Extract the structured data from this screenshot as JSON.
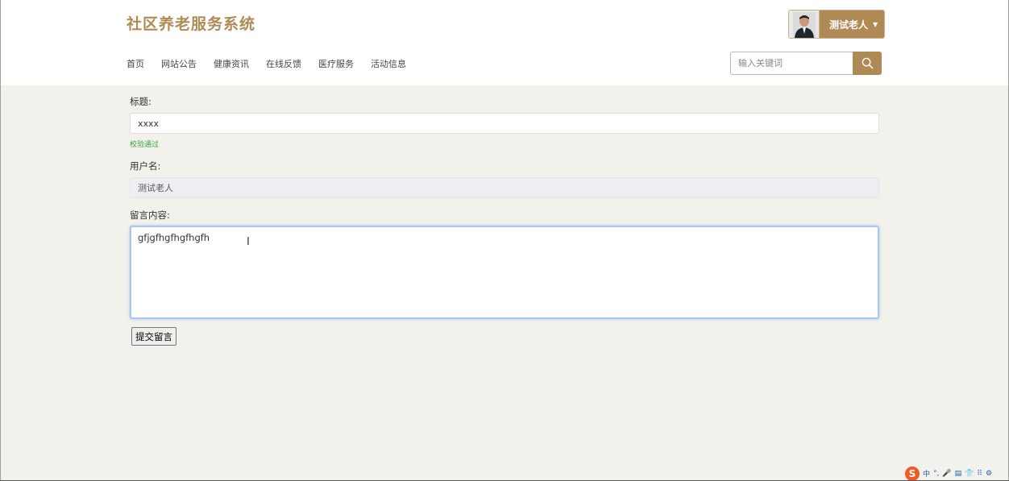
{
  "header": {
    "site_title": "社区养老服务系统",
    "user_name": "测试老人",
    "nav": [
      "首页",
      "网站公告",
      "健康资讯",
      "在线反馈",
      "医疗服务",
      "活动信息"
    ],
    "search_placeholder": "输入关键词"
  },
  "form": {
    "title_label": "标题:",
    "title_value": "xxxx",
    "title_validation": "校验通过",
    "username_label": "用户名:",
    "username_value": "测试老人",
    "content_label": "留言内容:",
    "content_value": "gfjgfhgfhgfhgfh",
    "submit_label": "提交留言"
  },
  "ime": {
    "logo": "S",
    "items": [
      "中",
      "°,",
      "🎤",
      "▤",
      "👕",
      "⠿",
      "⚙"
    ]
  },
  "colors": {
    "accent": "#b08a55",
    "background": "#f2f1ec",
    "valid": "#3aa33a"
  }
}
